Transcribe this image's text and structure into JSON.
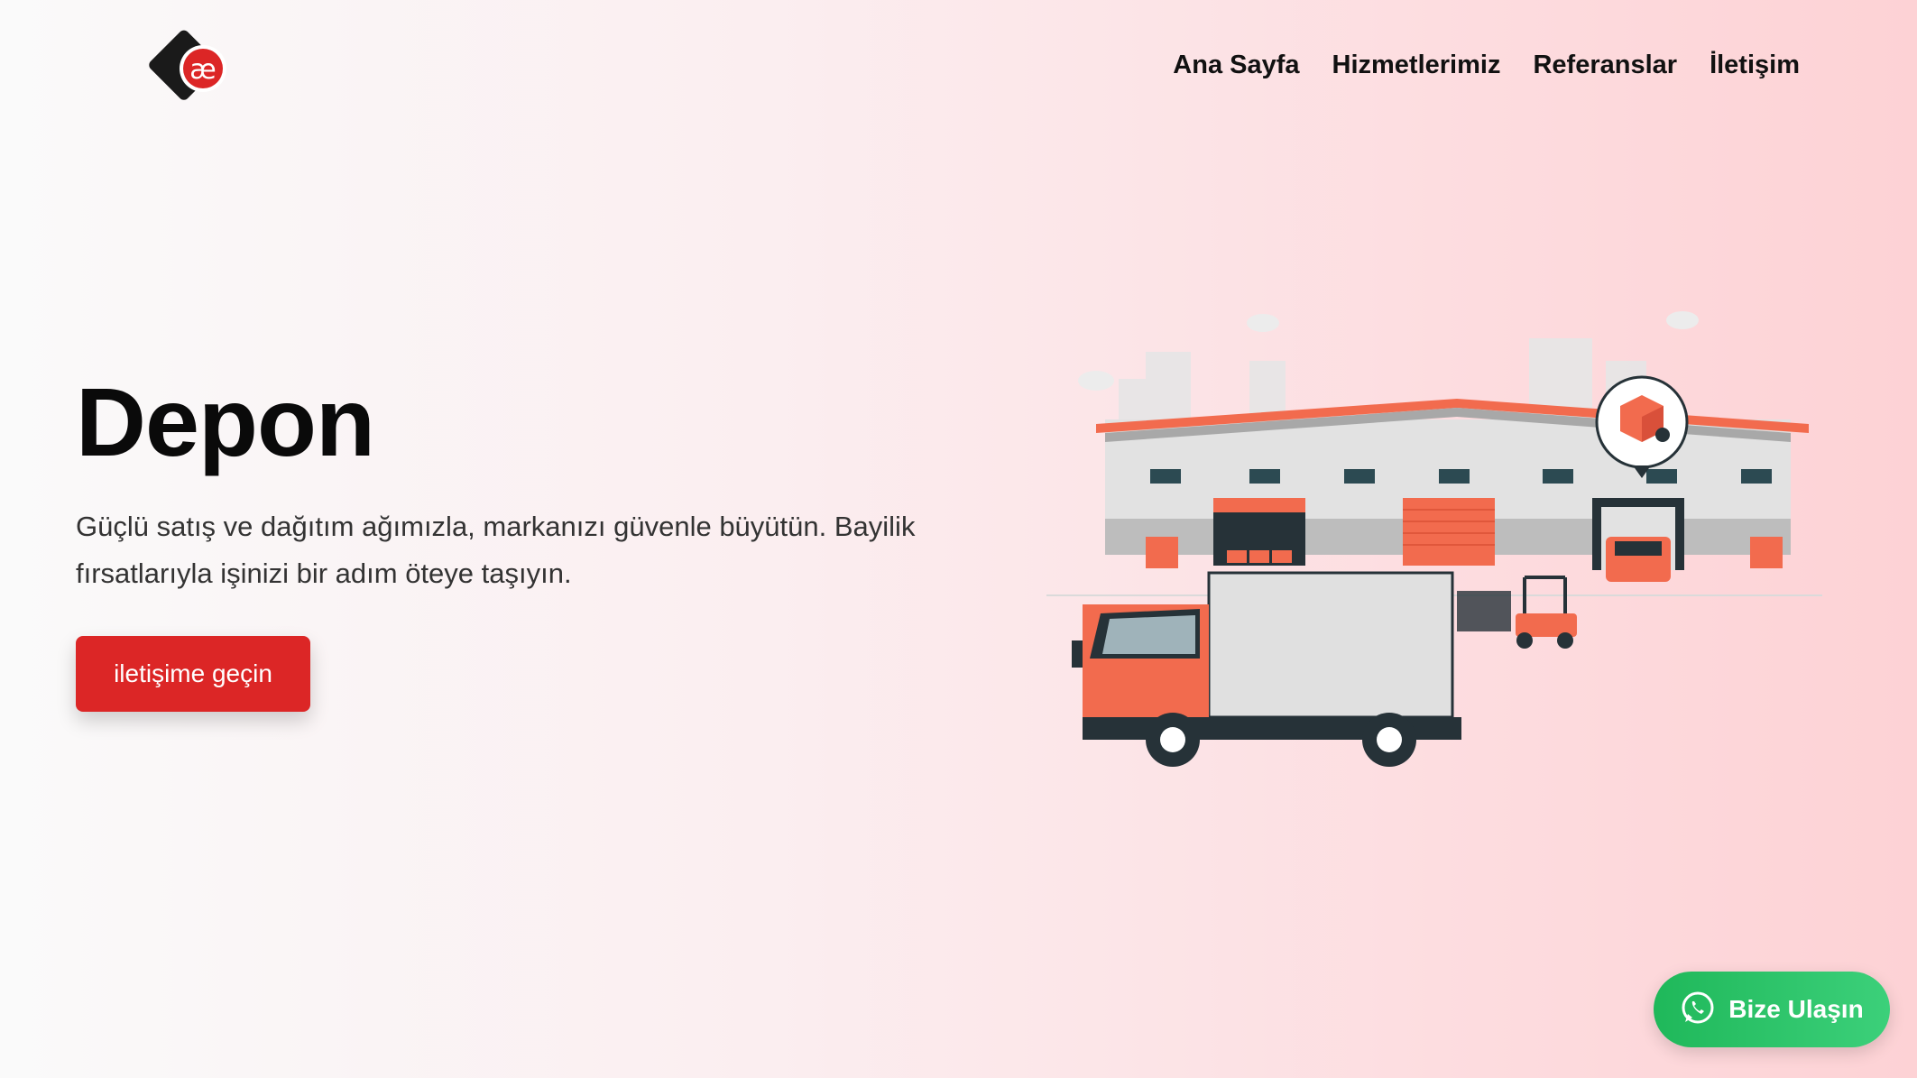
{
  "brand": {
    "logo_text": "æ",
    "accent": "#dc2626",
    "logo_dark": "#1a1a1a"
  },
  "nav": {
    "items": [
      {
        "label": "Ana Sayfa"
      },
      {
        "label": "Hizmetlerimiz"
      },
      {
        "label": "Referanslar"
      },
      {
        "label": "İletişim"
      }
    ]
  },
  "hero": {
    "title": "Depon",
    "subtitle": "Güçlü satış ve dağıtım ağımızla, markanızı güvenle büyütün. Bayilik fırsatlarıyla işinizi bir adım öteye taşıyın.",
    "cta_label": "iletişime geçin",
    "illustration_icon": "warehouse-truck-illustration"
  },
  "whatsapp": {
    "label": "Bize Ulaşın",
    "icon": "whatsapp-icon",
    "color": "#25d366"
  }
}
